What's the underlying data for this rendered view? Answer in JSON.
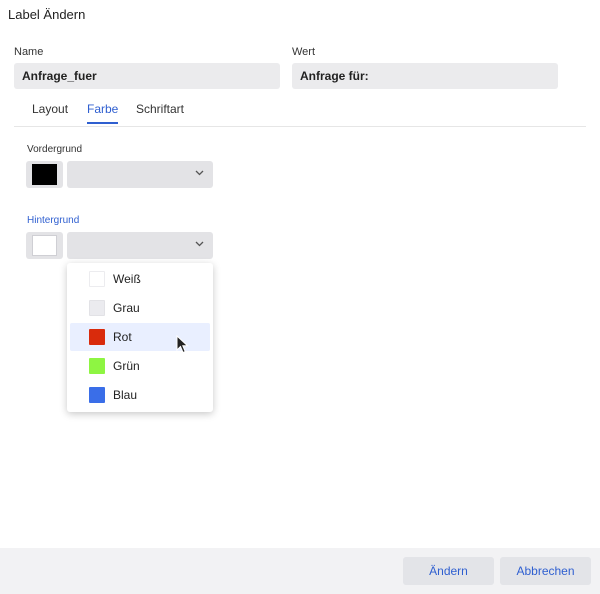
{
  "window": {
    "title": "Label Ändern"
  },
  "fields": {
    "name_label": "Name",
    "name_value": "Anfrage_fuer",
    "wert_label": "Wert",
    "wert_value": "Anfrage für:"
  },
  "tabs": [
    {
      "label": "Layout",
      "active": false
    },
    {
      "label": "Farbe",
      "active": true
    },
    {
      "label": "Schriftart",
      "active": false
    }
  ],
  "vordergrund": {
    "label": "Vordergrund",
    "color": "#000000",
    "selected": ""
  },
  "hintergrund": {
    "label": "Hintergrund",
    "color": "#ffffff",
    "selected": ""
  },
  "color_options": [
    {
      "label": "Weiß",
      "color": "#ffffff"
    },
    {
      "label": "Grau",
      "color": "#ebebef"
    },
    {
      "label": "Rot",
      "color": "#d92b0c",
      "highlighted": true
    },
    {
      "label": "Grün",
      "color": "#8ef542"
    },
    {
      "label": "Blau",
      "color": "#3a6ee8"
    }
  ],
  "footer": {
    "apply_label": "Ändern",
    "cancel_label": "Abbrechen"
  },
  "colors": {
    "accent": "#2f5fd0"
  }
}
